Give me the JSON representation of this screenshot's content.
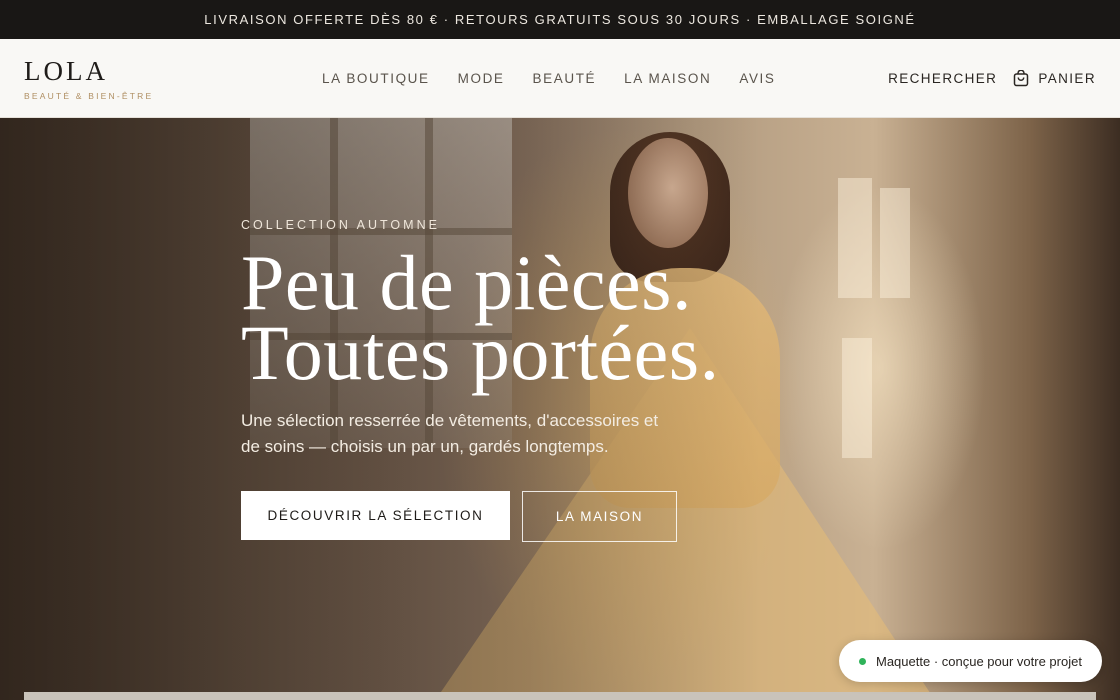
{
  "announcement": {
    "text": "Livraison offerte dès 80 € · Retours gratuits sous 30 jours · Emballage soigné"
  },
  "brand": {
    "name": "LOLA",
    "tagline": "Beauté & Bien-être"
  },
  "nav": {
    "items": [
      {
        "label": "La boutique"
      },
      {
        "label": "Mode"
      },
      {
        "label": "Beauté"
      },
      {
        "label": "La maison"
      },
      {
        "label": "Avis"
      }
    ]
  },
  "actions": {
    "search_label": "Rechercher",
    "cart_label": "Panier",
    "cart_icon": "shopping-bag-icon"
  },
  "hero": {
    "eyebrow": "Collection automne",
    "headline_line1": "Peu de pièces.",
    "headline_line2": "Toutes portées.",
    "lede": "Une sélection resserrée de vêtements, d'accessoires et de soins — choisis un par un, gardés longtemps.",
    "primary_cta": "Découvrir la sélection",
    "secondary_cta": "La maison"
  },
  "badge": {
    "text": "Maquette · conçue pour votre projet",
    "status_color": "#2fb35a"
  },
  "colors": {
    "announcement_bg": "#191715",
    "tagline_accent": "#b08f63",
    "header_bg": "#f9f8f5"
  }
}
